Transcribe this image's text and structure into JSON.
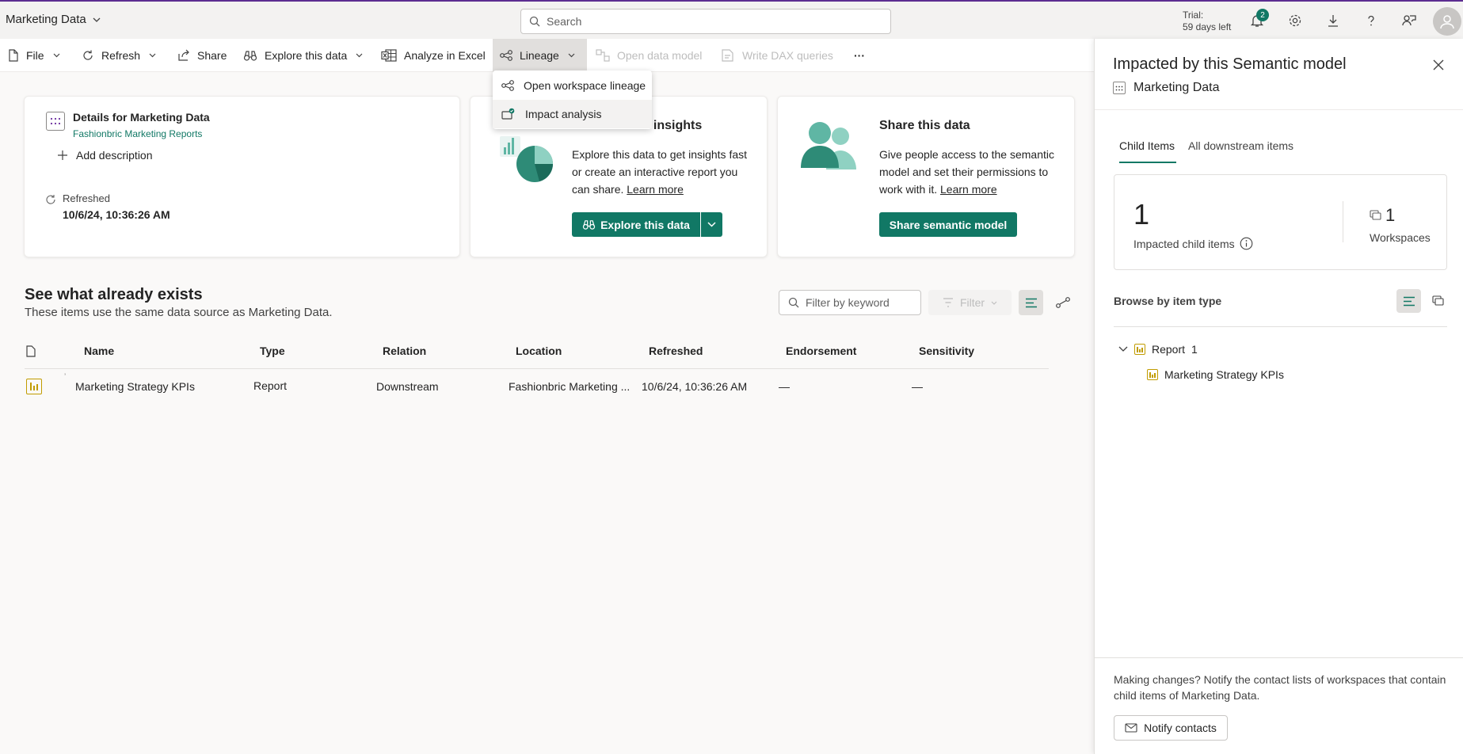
{
  "topbar": {
    "app_title": "Marketing Data",
    "search_placeholder": "Search",
    "trial_line1": "Trial:",
    "trial_line2": "59 days left",
    "notification_count": "2"
  },
  "toolbar": {
    "file": "File",
    "refresh": "Refresh",
    "share": "Share",
    "explore": "Explore this data",
    "analyze": "Analyze in Excel",
    "lineage": "Lineage",
    "open_model": "Open data model",
    "write_dax": "Write DAX queries",
    "more": "···"
  },
  "lineage_menu": {
    "items": [
      {
        "label": "Open workspace lineage"
      },
      {
        "label": "Impact analysis"
      }
    ]
  },
  "details_card": {
    "title": "Details for Marketing Data",
    "workspace": "Fashionbric Marketing Reports",
    "add_description": "Add description",
    "refreshed_label": "Refreshed",
    "refreshed_value": "10/6/24, 10:36:26 AM"
  },
  "insights_card": {
    "title": "ness insights",
    "body_line1": "Explore this data to get insights fast",
    "body_line2": "or create an interactive report you",
    "body_line3": "can share.",
    "learn_more": "Learn more",
    "button": "Explore this data"
  },
  "share_card": {
    "title": "Share this data",
    "body_line1": "Give people access to the semantic",
    "body_line2": "model and set their permissions to",
    "body_line3": "work with it.",
    "learn_more": "Learn more",
    "button": "Share semantic model"
  },
  "existing": {
    "title": "See what already exists",
    "subtitle": "These items use the same data source as Marketing Data.",
    "filter_placeholder": "Filter by keyword",
    "filter_button": "Filter",
    "columns": [
      "Name",
      "Type",
      "Relation",
      "Location",
      "Refreshed",
      "Endorsement",
      "Sensitivity"
    ],
    "rows": [
      {
        "name": "Marketing Strategy KPIs",
        "type": "Report",
        "relation": "Downstream",
        "location": "Fashionbric Marketing ...",
        "refreshed": "10/6/24, 10:36:26 AM",
        "endorsement": "—",
        "sensitivity": "—"
      }
    ]
  },
  "panel": {
    "title": "Impacted by this Semantic model",
    "subtitle": "Marketing Data",
    "tab_child": "Child Items",
    "tab_all": "All downstream items",
    "impacted_count": "1",
    "impacted_label": "Impacted child items",
    "workspace_count": "1",
    "workspace_label": "Workspaces",
    "browse_label": "Browse by item type",
    "tree_group": "Report",
    "tree_group_count": "1",
    "tree_item": "Marketing Strategy KPIs",
    "footer_text_line1": "Making changes? Notify the contact lists of workspaces that contain",
    "footer_text_line2": "child items of Marketing Data.",
    "notify_button": "Notify contacts"
  },
  "colors": {
    "accent": "#117865",
    "report_icon": "#c19c00",
    "topbar_border": "#5c2d91"
  }
}
